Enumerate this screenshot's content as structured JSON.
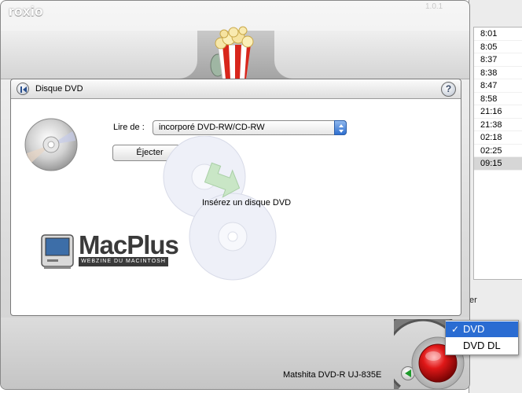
{
  "app": {
    "logo": "roxio",
    "version": "1.0.1"
  },
  "panel": {
    "title": "Disque DVD",
    "help_label": "?",
    "source": {
      "label": "Lire de :",
      "value": "incorporé DVD-RW/CD-RW"
    },
    "eject_label": "Éjecter",
    "insert_message": "Insérez un disque DVD"
  },
  "branding": {
    "wordmark": "MacPlus",
    "tagline": "WEBZINE DU MACINTOSH"
  },
  "footer": {
    "drive_label": "Matshita DVD-R    UJ-835E"
  },
  "format_menu": {
    "items": [
      {
        "label": "DVD",
        "selected": true
      },
      {
        "label": "DVD DL",
        "selected": false
      }
    ]
  },
  "background_window": {
    "times": [
      "8:01",
      "8:05",
      "8:37",
      "8:38",
      "8:47",
      "8:58",
      "21:16",
      "21:38",
      "02:18",
      "02:25",
      "09:15"
    ],
    "side_text": "er"
  },
  "colors": {
    "menu_highlight": "#2a6cd2",
    "record_button": "#d01010",
    "select_arrow": "#2f6fcf"
  }
}
